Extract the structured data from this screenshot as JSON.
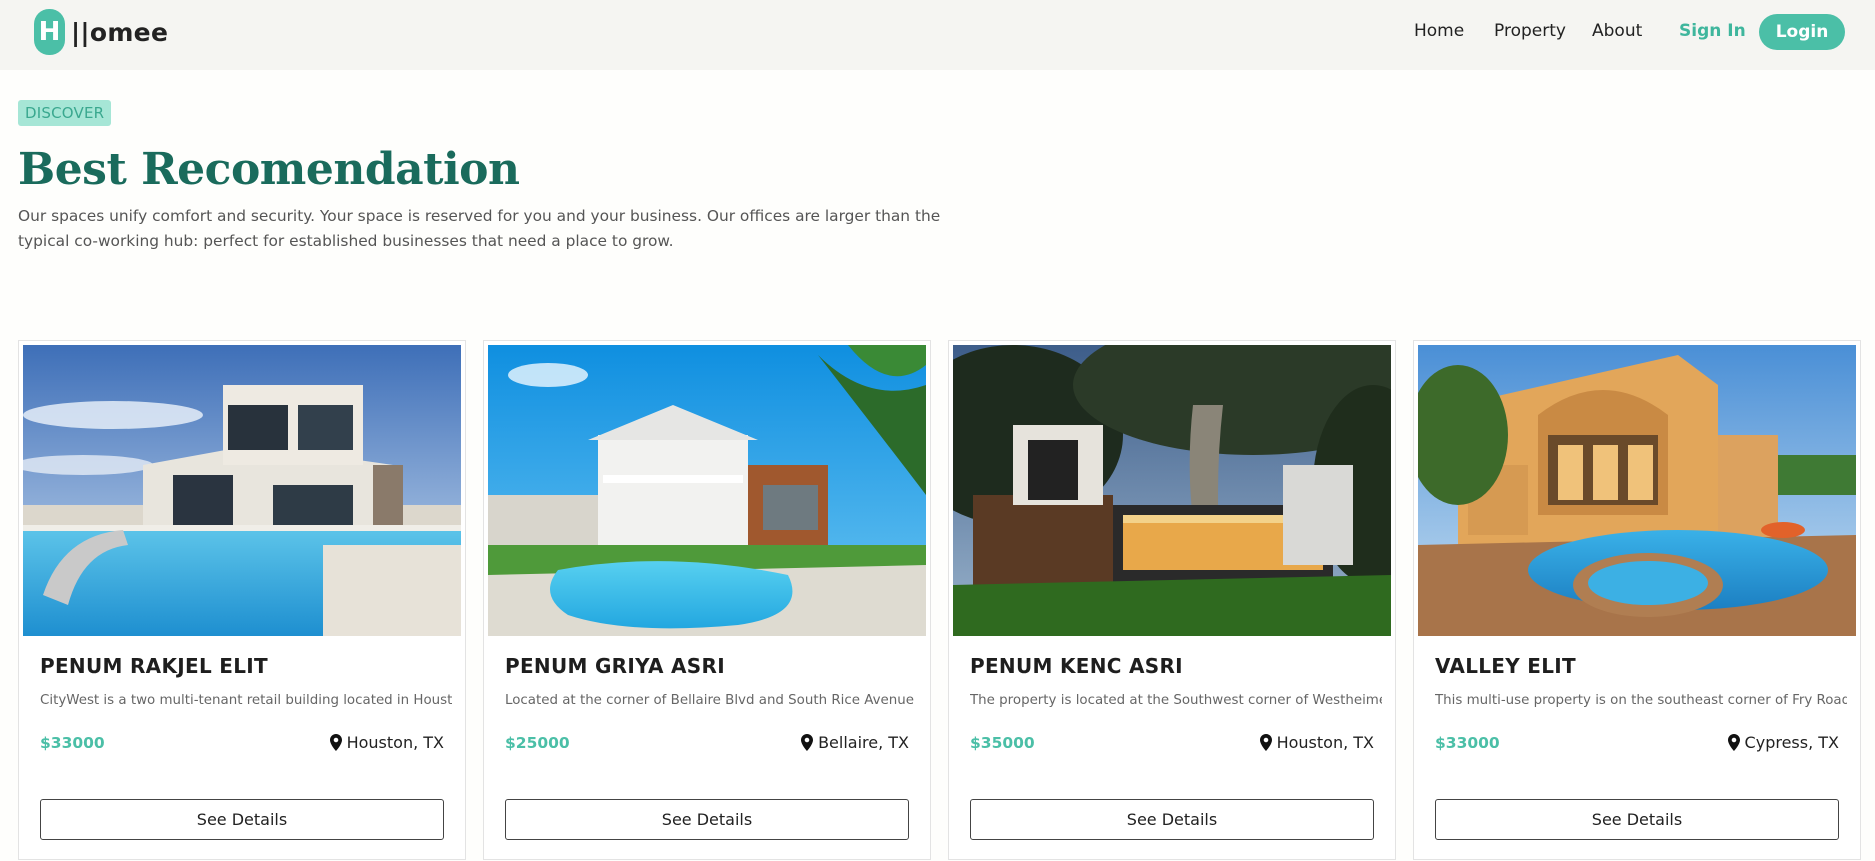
{
  "brand": {
    "logo_letter": "H",
    "name": "||omee"
  },
  "nav": {
    "home": "Home",
    "property": "Property",
    "about": "About",
    "sign_in": "Sign In",
    "login": "Login"
  },
  "hero": {
    "badge": "DISCOVER",
    "title": "Best Recomendation",
    "description": "Our spaces unify comfort and security. Your space is reserved for you and your business. Our offices are larger than the typical co-working hub: perfect for established businesses that need a place to grow."
  },
  "cards": [
    {
      "title": "PENUM RAKJEL ELIT",
      "description": "CityWest is a two multi-tenant retail building located in Houston",
      "price": "$33000",
      "location": "Houston, TX",
      "button": "See Details"
    },
    {
      "title": "PENUM GRIYA ASRI",
      "description": "Located at the corner of Bellaire Blvd and South Rice Avenue",
      "price": "$25000",
      "location": "Bellaire, TX",
      "button": "See Details"
    },
    {
      "title": "PENUM KENC ASRI",
      "description": "The property is located at the Southwest corner of Westheimer",
      "price": "$35000",
      "location": "Houston, TX",
      "button": "See Details"
    },
    {
      "title": "VALLEY ELIT",
      "description": "This multi-use property is on the southeast corner of Fry Road",
      "price": "$33000",
      "location": "Cypress, TX",
      "button": "See Details"
    }
  ],
  "colors": {
    "accent": "#4bbfa7",
    "title": "#1a6b5c",
    "badge_bg": "#a6e6d6"
  },
  "icons": {
    "location": "map-pin-icon"
  }
}
